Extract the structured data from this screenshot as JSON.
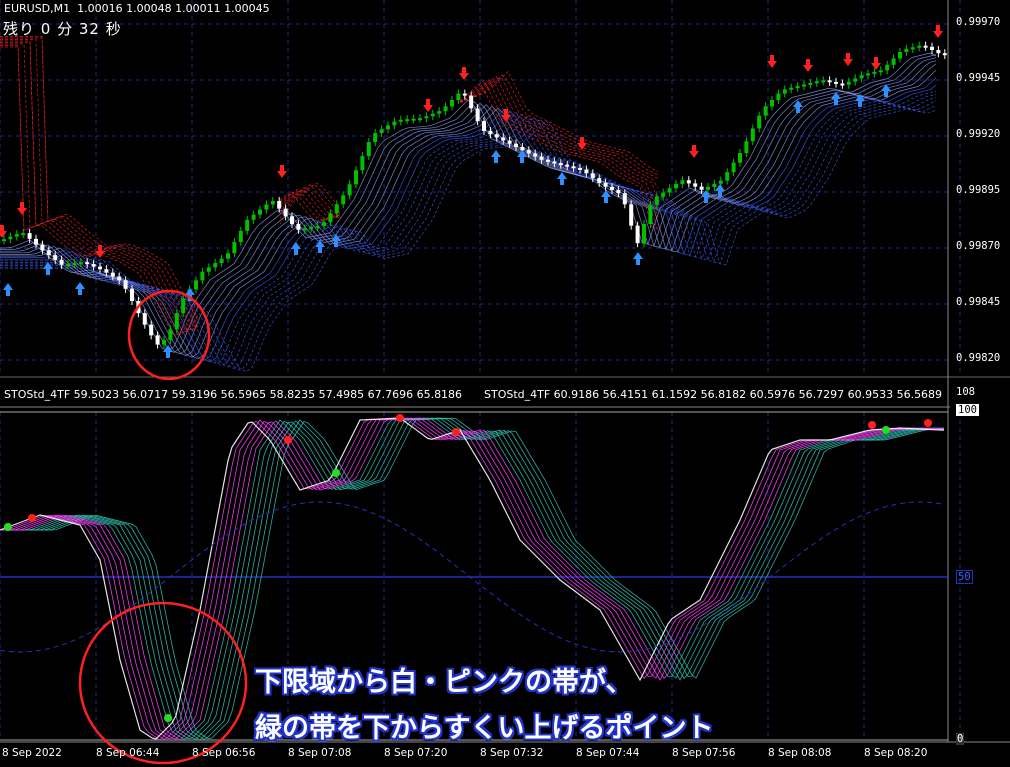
{
  "header": {
    "symbol_line": "EURUSD,M1  1.00016 1.00048 1.00011 1.00045",
    "timer": "残り 0 分 32 秒"
  },
  "price_axis": [
    "0.99970",
    "0.99945",
    "0.99920",
    "0.99895",
    "0.99870",
    "0.99845",
    "0.99820"
  ],
  "sub_window": {
    "indicator_line_1": "STOStd_4TF 59.5023 56.0717 59.3196 56.5965 58.8235 57.4985 67.7696 65.8186",
    "indicator_line_2": "STOStd_4TF 60.9186 56.4151 61.1592 56.8182 60.5976 56.7297 60.9533 56.5689",
    "scale_max": "108",
    "level_100": "100",
    "level_50": "50",
    "level_0": "0"
  },
  "time_axis": [
    "8 Sep 2022",
    "8 Sep 06:44",
    "8 Sep 06:56",
    "8 Sep 07:08",
    "8 Sep 07:20",
    "8 Sep 07:32",
    "8 Sep 07:44",
    "8 Sep 07:56",
    "8 Sep 08:08",
    "8 Sep 08:20"
  ],
  "annotation": {
    "line1": "下限域から白・ピンクの帯が、",
    "line2": "緑の帯を下からすくい上げるポイント"
  },
  "colors": {
    "background": "#000000",
    "grid": "#1c2a8c",
    "bull_candle": "#00c000",
    "bear_candle": "#ffffff",
    "red_band": "#ff2020",
    "blue_band": "#4060ff",
    "sell_arrow": "#ff2020",
    "buy_arrow": "#2f8fff",
    "circle": "#ff2020",
    "magenta": "#ff40ff",
    "teal": "#30c0b0"
  }
}
